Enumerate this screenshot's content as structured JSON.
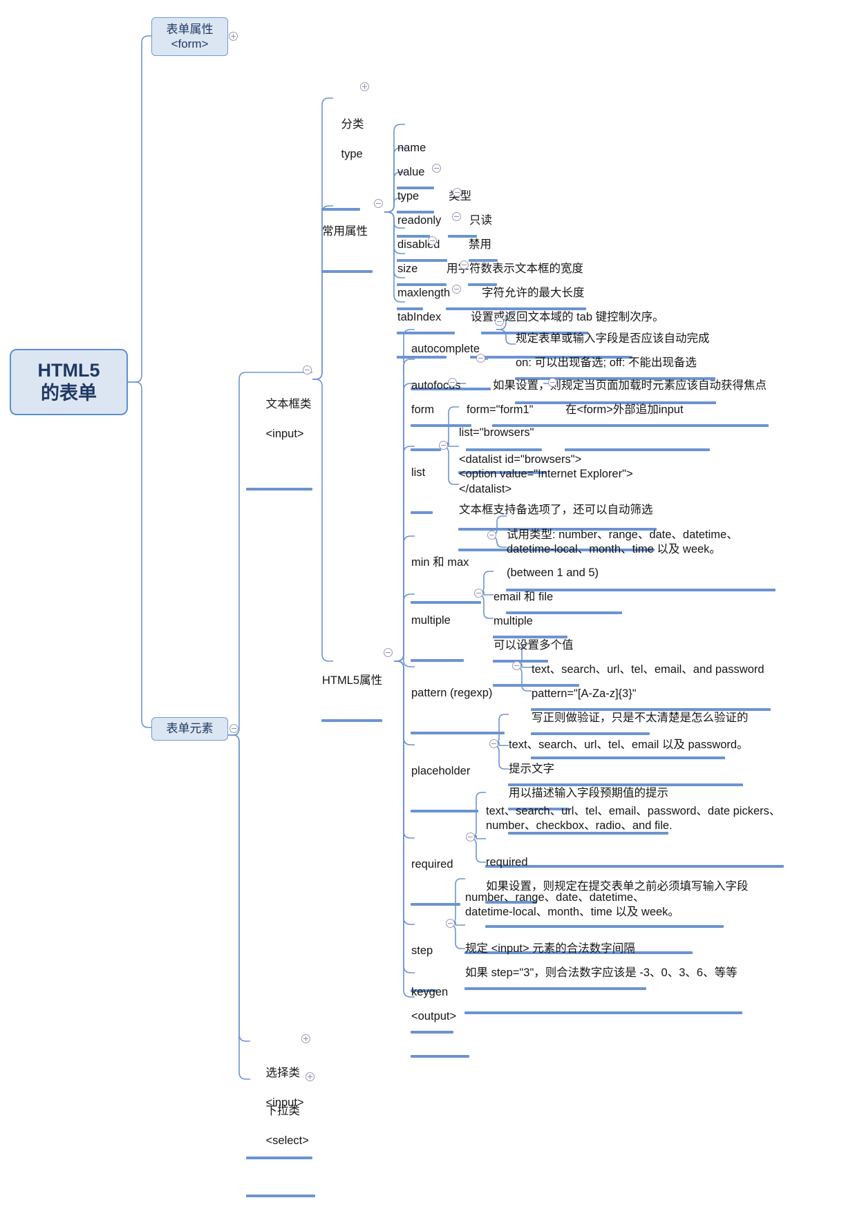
{
  "diagram": {
    "title": "HTML5 的表单",
    "root": {
      "line1": "HTML5",
      "line2": "的表单"
    },
    "toggle_icons": {
      "expand": "plus-circle-icon",
      "collapse": "minus-circle-icon"
    },
    "colors": {
      "node_fill": "#dce6f2",
      "node_border": "#5b8fd0",
      "branch_line": "#6b93d0",
      "root_text": "#1f3864",
      "text": "#161616",
      "toggle": "#9b97b8"
    },
    "branches": [
      {
        "id": "form-attr",
        "label_line1": "表单属性",
        "label_line2": "<form>",
        "boxed": true,
        "toggle": "plus"
      },
      {
        "id": "form-elements",
        "label": "表单元素",
        "boxed": true,
        "toggle": "minus"
      }
    ],
    "nodes": {
      "fenlei": {
        "line1": "分类",
        "line2": "type",
        "toggle": "plus"
      },
      "changyong": {
        "label": "常用属性",
        "toggle": "minus"
      },
      "textbox": {
        "line1": "文本框类",
        "line2": "<input>",
        "toggle": "minus"
      },
      "html5attrs": {
        "label": "HTML5属性",
        "toggle": "minus"
      },
      "select_class": {
        "line1": "选择类",
        "line2": "<input>",
        "toggle": "plus"
      },
      "dropdown_class": {
        "line1": "下拉类",
        "line2": "<select>",
        "toggle": "plus"
      }
    },
    "common_attributes": [
      {
        "name": "name",
        "toggle": null,
        "desc": null
      },
      {
        "name": "value",
        "toggle": null,
        "desc": null
      },
      {
        "name": "type",
        "toggle": "minus",
        "desc": "类型"
      },
      {
        "name": "readonly",
        "toggle": "minus",
        "desc": "只读"
      },
      {
        "name": "disabled",
        "toggle": "minus",
        "desc": "禁用"
      },
      {
        "name": "size",
        "toggle": "minus",
        "desc": "用字符数表示文本框的宽度"
      },
      {
        "name": "maxlength",
        "toggle": "minus",
        "desc": "字符允许的最大长度"
      },
      {
        "name": "tabIndex",
        "toggle": "minus",
        "desc": "设置或返回文本域的 tab 键控制次序。"
      }
    ],
    "html5_attributes": [
      {
        "name": "autocomplete",
        "toggle": "minus",
        "children": [
          {
            "text": "规定表单或输入字段是否应该自动完成"
          },
          {
            "text": "on: 可以出现备选; off: 不能出现备选"
          }
        ]
      },
      {
        "name": "autofocus",
        "toggle": "minus",
        "children": [
          {
            "text": "如果设置，则规定当页面加载时元素应该自动获得焦点"
          }
        ]
      },
      {
        "name": "form",
        "toggle": "minus",
        "children": [
          {
            "text": "form=\"form1\"",
            "toggle": "minus",
            "children": [
              {
                "text": "在<form>外部追加input"
              }
            ]
          }
        ]
      },
      {
        "name": "list",
        "toggle": "minus",
        "children": [
          {
            "text": "list=\"browsers\""
          },
          {
            "text": "<datalist id=\"browsers\">\n<option value=\"Internet Explorer\">\n</datalist>"
          },
          {
            "text": "文本框支持备选项了，还可以自动筛选"
          }
        ]
      },
      {
        "name": "min 和 max",
        "toggle": "minus",
        "children": [
          {
            "text": "试用类型: number、range、date、datetime、\ndatetime-local、month、time 以及 week。"
          },
          {
            "text": "(between 1 and 5)"
          }
        ]
      },
      {
        "name": "multiple",
        "toggle": "minus",
        "children": [
          {
            "text": "email 和 file"
          },
          {
            "text": "multiple"
          },
          {
            "text": "可以设置多个值"
          }
        ]
      },
      {
        "name": "pattern (regexp)",
        "toggle": "minus",
        "children": [
          {
            "text": "text、search、url、tel、email、and password"
          },
          {
            "text": "pattern=\"[A-Za-z]{3}\""
          },
          {
            "text": "写正则做验证，只是不太清楚是怎么验证的"
          }
        ]
      },
      {
        "name": "placeholder",
        "toggle": "minus",
        "children": [
          {
            "text": "text、search、url、tel、email 以及 password。"
          },
          {
            "text": "提示文字"
          },
          {
            "text": "用以描述输入字段预期值的提示"
          }
        ]
      },
      {
        "name": "required",
        "toggle": "minus",
        "children": [
          {
            "text": "text、search、url、tel、email、password、date pickers、\nnumber、checkbox、radio、and file."
          },
          {
            "text": "required"
          },
          {
            "text": "如果设置，则规定在提交表单之前必须填写输入字段"
          }
        ]
      },
      {
        "name": "step",
        "toggle": "minus",
        "children": [
          {
            "text": "number、range、date、datetime、\ndatetime-local、month、time 以及 week。"
          },
          {
            "text": "规定 <input> 元素的合法数字间隔"
          },
          {
            "text": "如果 step=\"3\"，则合法数字应该是 -3、0、3、6、等等"
          }
        ]
      },
      {
        "name": "keygen",
        "toggle": null,
        "children": []
      },
      {
        "name": "<output>",
        "toggle": null,
        "children": []
      }
    ]
  }
}
